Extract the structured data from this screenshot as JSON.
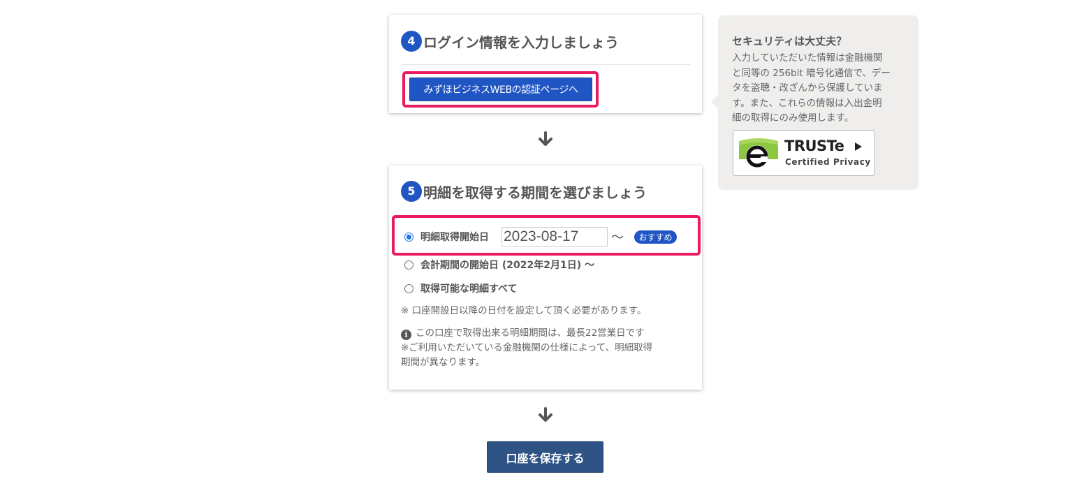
{
  "step4": {
    "number": "4",
    "title": "ログイン情報を入力しましょう",
    "auth_button_label": "みずほビジネスWEBの認証ページへ"
  },
  "step5": {
    "number": "5",
    "title": "明細を取得する期間を選びましょう",
    "options": [
      {
        "label": "明細取得開始日",
        "selected": true
      },
      {
        "label": "会計期間の開始日 (2022年2月1日) ～",
        "selected": false
      },
      {
        "label": "取得可能な明細すべて",
        "selected": false
      }
    ],
    "start_date_value": "2023-08-17",
    "tilde": "～",
    "recommended_badge": "おすすめ",
    "note": "※ 口座開設日以降の日付を設定して頂く必要があります。",
    "info_lines": [
      "この口座で取得出来る明細期間は、最長22営業日です",
      "※ご利用いただいている金融機関の仕様によって、明細取得",
      "期間が異なります。"
    ]
  },
  "save_button_label": "口座を保存する",
  "security": {
    "title": "セキュリティは大丈夫？",
    "body_lines": [
      "入力していただいた情報は金融機関",
      "と同等の 256bit 暗号化通信で、デー",
      "タを盗聴・改ざんから保護していま",
      "す。また、これらの情報は入出金明",
      "細の取得にのみ使用します。"
    ],
    "badge": {
      "name": "TRUSTe",
      "subtitle": "Certified Privacy"
    }
  },
  "colors": {
    "primary_blue": "#2055c4",
    "save_navy": "#2e5384",
    "highlight_pink": "#ea1b5d",
    "truste_green": "#8dc63f"
  }
}
